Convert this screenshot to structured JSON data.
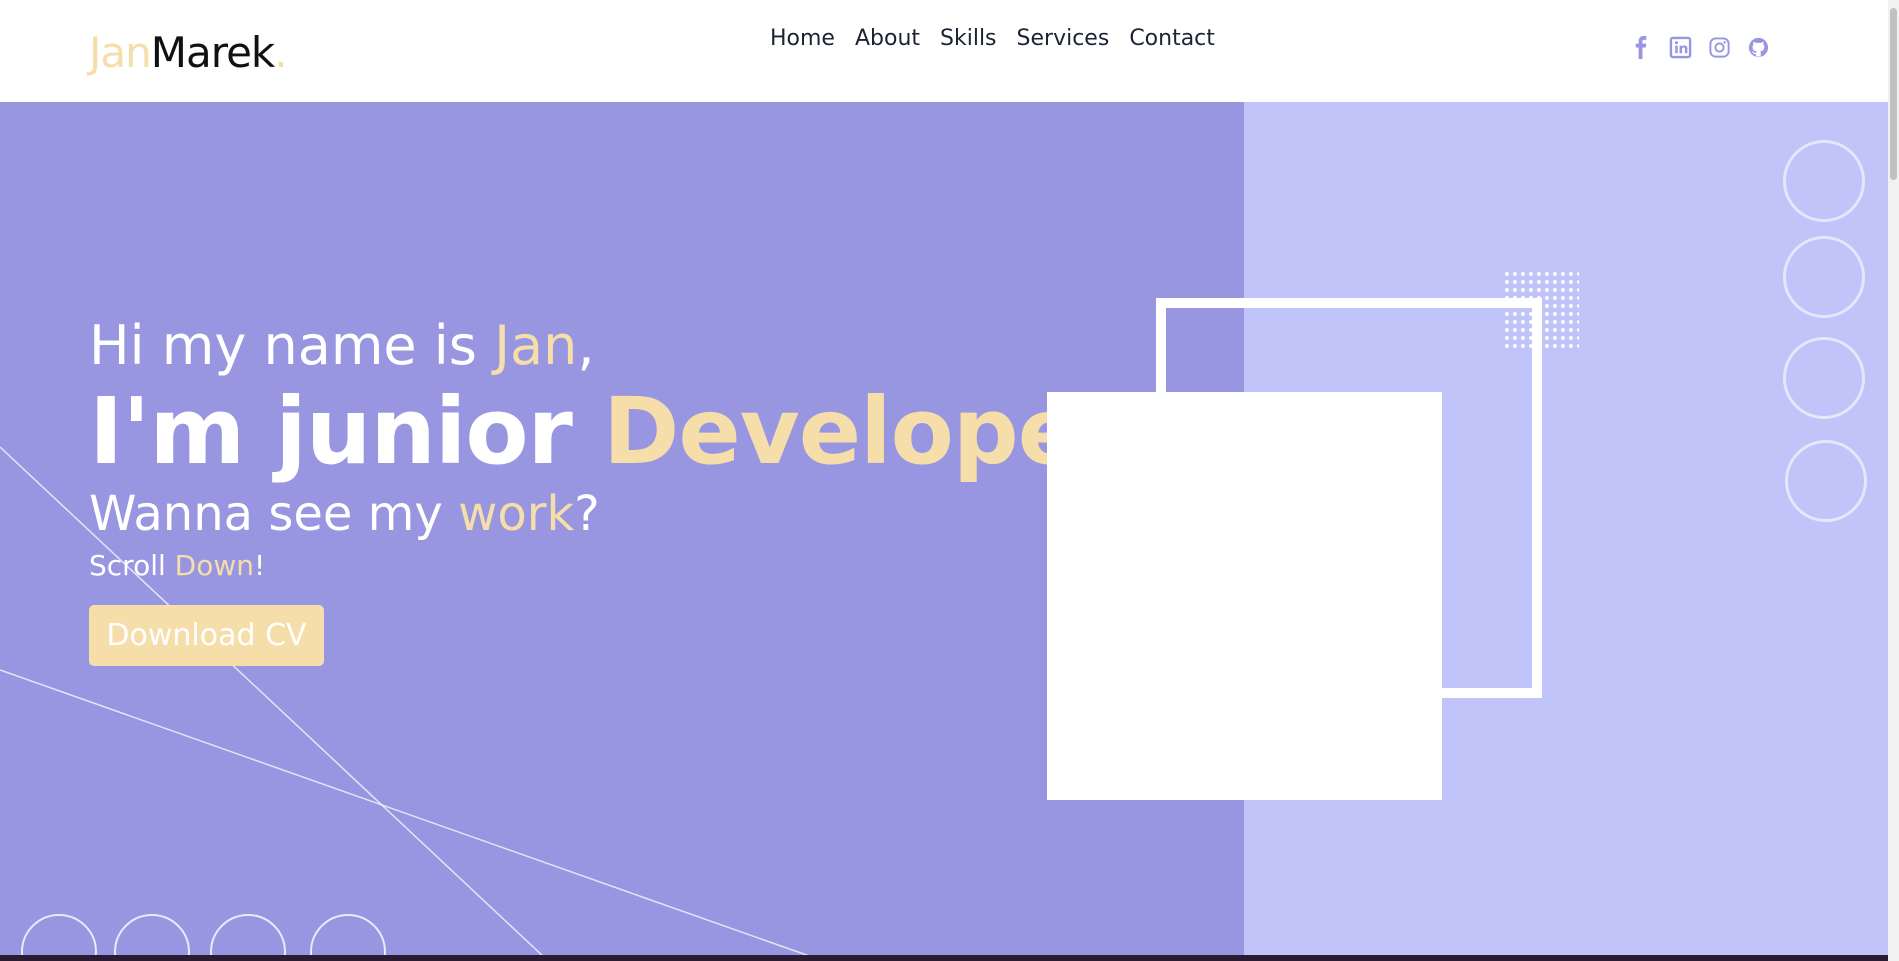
{
  "logo": {
    "part1": "Jan",
    "part2": "Marek",
    "dot": "."
  },
  "nav": {
    "items": [
      "Home",
      "About",
      "Skills",
      "Services",
      "Contact"
    ]
  },
  "social": {
    "icons": [
      "facebook-icon",
      "linkedin-icon",
      "instagram-icon",
      "github-icon"
    ],
    "color": "#9896e0"
  },
  "hero": {
    "greeting_prefix": "Hi my name is ",
    "greeting_name": "Jan",
    "greeting_suffix": ",",
    "headline_prefix": "I'm junior ",
    "headline_role": "Developer",
    "headline_suffix": ".",
    "sub_prefix": "Wanna see my ",
    "sub_accent": "work",
    "sub_suffix": "?",
    "scroll_prefix": "Scroll ",
    "scroll_accent": "Down",
    "scroll_suffix": "!",
    "cta_label": "Download CV"
  },
  "colors": {
    "accent": "#f5deaa",
    "hero_left_bg": "#9896e0",
    "hero_right_bg": "#c0c4f8",
    "nav_text": "#1c2333"
  }
}
